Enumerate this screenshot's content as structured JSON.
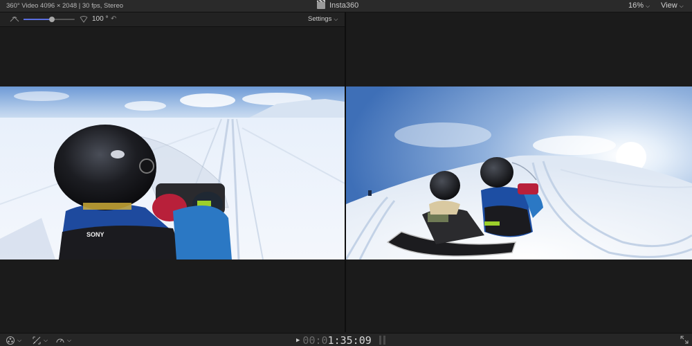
{
  "topbar": {
    "video_info": "360° Video 4096 × 2048 | 30 fps, Stereo",
    "title": "Insta360",
    "zoom": "16%",
    "view_label": "View",
    "clapper_icon": "clapperboard-icon"
  },
  "viewer_controls": {
    "fov_min_icon": "field-of-view-narrow-icon",
    "fov_max_icon": "field-of-view-wide-icon",
    "fov_slider_value": 0.55,
    "angle": "100 °",
    "reset_icon": "reset-icon",
    "settings_label": "Settings"
  },
  "bottombar": {
    "timecode_dim": "00:0",
    "timecode_main": "1:35:09",
    "play_icon": "play-icon",
    "fullscreen_icon": "fullscreen-icon",
    "tool_icons": [
      "effects-icon",
      "transform-icon",
      "speed-icon"
    ]
  },
  "colors": {
    "accent": "#5a6ee0",
    "background": "#1b1b1b",
    "toolbar": "#2a2a2a"
  }
}
